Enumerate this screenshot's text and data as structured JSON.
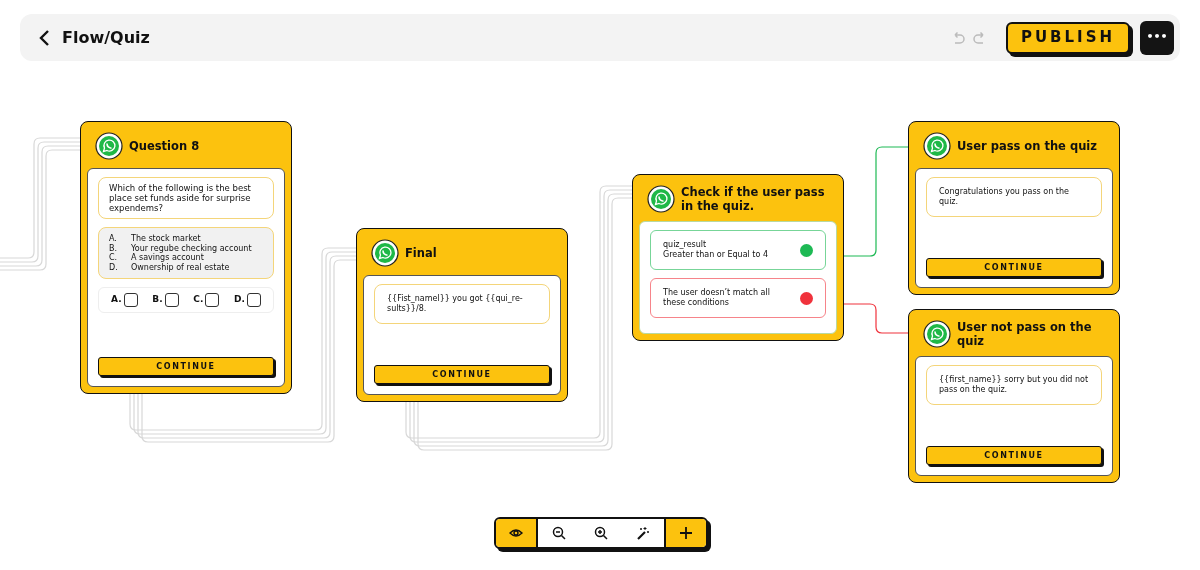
{
  "header": {
    "title": "Flow/Quiz",
    "publish": "PUBLISH",
    "more": "•••"
  },
  "nodes": [
    {
      "kind": "question",
      "title": "Question 8",
      "question": "Which of the following is the best place set funds aside for surprise expendems?",
      "options": [
        {
          "letter": "A.",
          "text": "The stock market"
        },
        {
          "letter": "B.",
          "text": "Your regube checking account"
        },
        {
          "letter": "C.",
          "text": "A savings account"
        },
        {
          "letter": "D.",
          "text": "Ownership of real estate"
        }
      ],
      "answers": [
        {
          "label": "A.",
          "checked": false
        },
        {
          "label": "B.",
          "checked": false
        },
        {
          "label": "C.",
          "checked": false
        },
        {
          "label": "D.",
          "checked": false
        }
      ],
      "button": "CONTINUE"
    },
    {
      "kind": "message",
      "title": "Final",
      "message": "{{Fist_namel}} you got {{qui_re-sults}}/8.",
      "button": "CONTINUE"
    },
    {
      "kind": "condition",
      "title": "Check if the user pass in the quiz.",
      "conditions": [
        {
          "lines": [
            "quiz_result",
            "Greater than or Equal to 4"
          ],
          "color": "#1db954"
        },
        {
          "lines": [
            "The user doesn’t match all these conditions"
          ],
          "color": "#f0323c"
        }
      ]
    },
    {
      "kind": "message",
      "title": "User pass on the quiz",
      "message": "Congratulations you pass on the quiz.",
      "button": "CONTINUE"
    },
    {
      "kind": "message",
      "title": "User not  pass on the quiz",
      "message": "{{first_name}} sorry but you did not pass on the quiz.",
      "button": "CONTINUE"
    }
  ],
  "toolbar": [
    {
      "kind": "preview",
      "selected": true
    },
    {
      "kind": "zoom-out",
      "selected": false
    },
    {
      "kind": "zoom-in",
      "selected": false
    },
    {
      "kind": "magic",
      "selected": false
    }
  ]
}
